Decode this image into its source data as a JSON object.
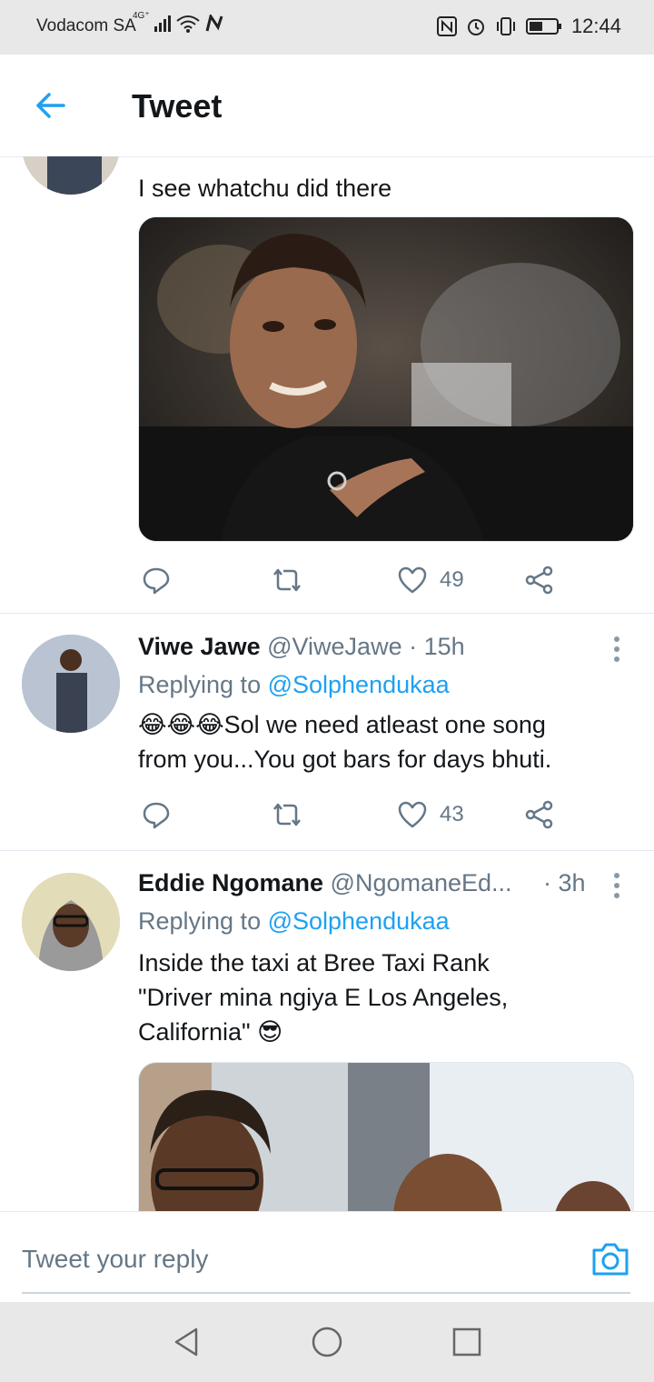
{
  "status_bar": {
    "carrier": "Vodacom SA",
    "network": "4G⁺",
    "time": "12:44"
  },
  "header": {
    "title": "Tweet"
  },
  "tweets": [
    {
      "text": "I see whatchu did there",
      "media_description": "photo",
      "likes": "49"
    },
    {
      "name": "Viwe Jawe",
      "handle": "@ViweJawe",
      "time": "· 15h",
      "replying_prefix": "Replying to ",
      "replying_to": "@Solphendukaa",
      "text_line1": "😂😂😂Sol we need atleast one song",
      "text_line2": "from you...You got bars for days bhuti.",
      "likes": "43"
    },
    {
      "name": "Eddie Ngomane",
      "handle": "@NgomaneEd...",
      "time": "· 3h",
      "replying_prefix": "Replying to ",
      "replying_to": "@Solphendukaa",
      "text_line1": "Inside the taxi at Bree Taxi Rank",
      "text_line2": "\"Driver mina ngiya E Los Angeles,",
      "text_line3": "California\" 😎"
    }
  ],
  "reply_bar": {
    "placeholder": "Tweet your reply"
  },
  "colors": {
    "accent": "#1da1f2",
    "secondary_text": "#657786",
    "divider": "#e1e8ed"
  }
}
